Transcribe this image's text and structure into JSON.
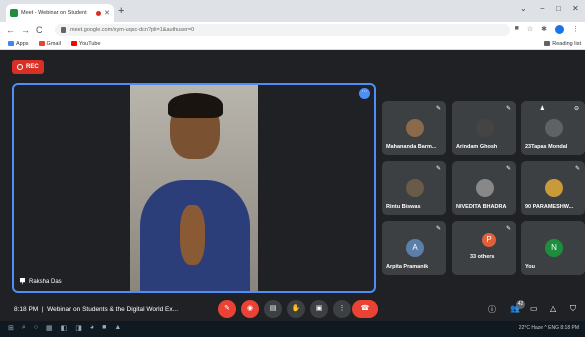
{
  "browser": {
    "tab_title": "Meet - Webinar on Student",
    "new_tab": "+",
    "url": "meet.google.com/xym-uqsc-dcn?pli=1&authuser=0",
    "bookmarks": [
      "Apps",
      "Gmail",
      "YouTube"
    ],
    "reading_list": "Reading list"
  },
  "meet": {
    "rec_label": "REC",
    "main_participant": "Raksha Das",
    "tiles": [
      {
        "name": "Mahananda Barm...",
        "type": "photo",
        "color": "#8a6a4a"
      },
      {
        "name": "Arindam Ghosh",
        "type": "photo",
        "color": "#444"
      },
      {
        "name": "23Tapas Mondal",
        "type": "muted-video",
        "color": "#5f6368"
      },
      {
        "name": "Rintu Biswas",
        "type": "photo",
        "color": "#6a5a4a"
      },
      {
        "name": "NIVEDITA BHADRA",
        "type": "photo",
        "color": "#888"
      },
      {
        "name": "90 PARAMESHW...",
        "type": "photo",
        "color": "#c99a3a"
      },
      {
        "name": "Arpita Pramanik",
        "type": "letter",
        "letter": "A",
        "color": "#5b7fa8"
      },
      {
        "name": "33 others",
        "type": "others",
        "color": "#e0603a"
      },
      {
        "name": "You",
        "type": "letter",
        "letter": "N",
        "color": "#1e8e3e"
      }
    ],
    "time": "8:18 PM",
    "meeting_title": "Webinar on Students & the Digital World Ex...",
    "participant_count": "42"
  },
  "taskbar": {
    "status": "22°C Haze ^ ENG 8:18 PM"
  }
}
